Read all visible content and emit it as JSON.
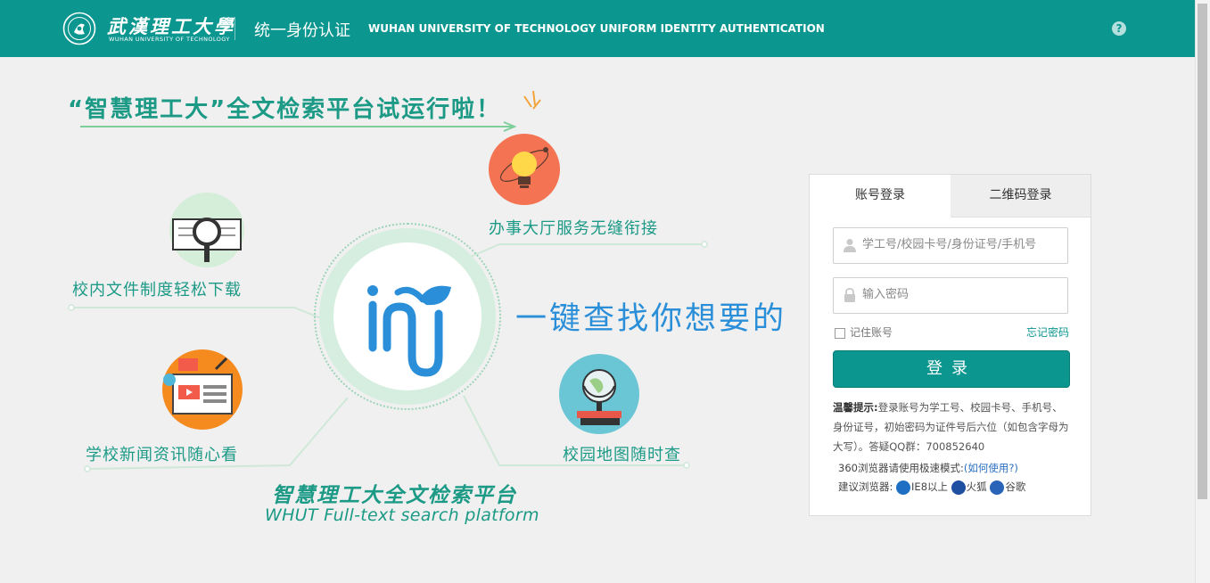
{
  "header": {
    "logo_cn": "武漢理工大學",
    "logo_en": "WUHAN UNIVERSITY OF TECHNOLOGY",
    "title_cn": "统一身份认证",
    "title_en": "WUHAN UNIVERSITY OF TECHNOLOGY UNIFORM IDENTITY AUTHENTICATION",
    "help_icon": "question-circle-icon",
    "help_glyph": "?"
  },
  "banner": {
    "headline": "“智慧理工大”全文检索平台试运行啦！",
    "slogan": "一键查找你想要的",
    "features": [
      {
        "label": "办事大厅服务无缝衔接",
        "icon": "lightbulb-icon"
      },
      {
        "label": "校内文件制度轻松下载",
        "icon": "magnifier-book-icon"
      },
      {
        "label": "学校新闻资讯随心看",
        "icon": "news-screen-icon"
      },
      {
        "label": "校园地图随时查",
        "icon": "globe-icon"
      }
    ],
    "platform_cn": "智慧理工大全文检索平台",
    "platform_en": "WHUT Full-text search platform"
  },
  "login": {
    "tabs": [
      {
        "label": "账号登录",
        "active": true
      },
      {
        "label": "二维码登录",
        "active": false
      }
    ],
    "username_placeholder": "学工号/校园卡号/身份证号/手机号",
    "password_placeholder": "输入密码",
    "remember_label": "记住账号",
    "forgot_label": "忘记密码",
    "submit_label": "登录",
    "tip_title": "温馨提示:",
    "tip_body": "登录账号为学工号、校园卡号、手机号、身份证号，初始密码为证件号后六位（如包含字母为大写）。答疑QQ群：700852640",
    "browser_360_text": "360浏览器请使用极速模式:",
    "browser_360_link": "(如何使用?)",
    "browser_suggest_label": "建议浏览器:",
    "browsers": [
      {
        "label": "IE8以上",
        "icon": "ie-icon",
        "color": "#1e6fc4"
      },
      {
        "label": "火狐",
        "icon": "firefox-icon",
        "color": "#1f4fa0"
      },
      {
        "label": "谷歌",
        "icon": "chrome-icon",
        "color": "#2a64b8"
      }
    ]
  },
  "colors": {
    "brand": "#0b9690",
    "green_text": "#1c9a86",
    "slogan_blue": "#2a8fd8",
    "page_bg": "#f0f0f0"
  }
}
